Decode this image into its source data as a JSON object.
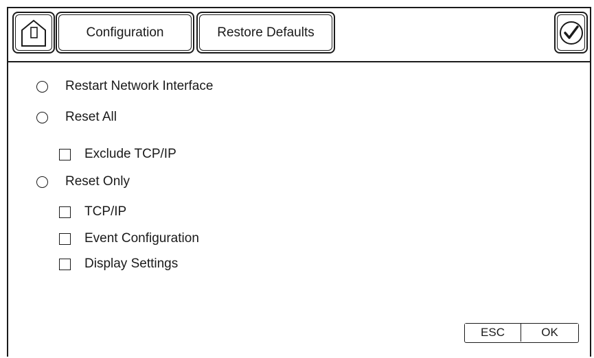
{
  "toolbar": {
    "home_icon": "home-icon",
    "configuration_label": "Configuration",
    "restore_defaults_label": "Restore Defaults",
    "confirm_icon": "checkmark-circle-icon"
  },
  "options": {
    "restart_network_interface": "Restart Network Interface",
    "reset_all": "Reset All",
    "exclude_tcpip": "Exclude TCP/IP",
    "reset_only": "Reset Only",
    "tcpip": "TCP/IP",
    "event_configuration": "Event Configuration",
    "display_settings": "Display Settings"
  },
  "footer": {
    "esc_label": "ESC",
    "ok_label": "OK"
  }
}
